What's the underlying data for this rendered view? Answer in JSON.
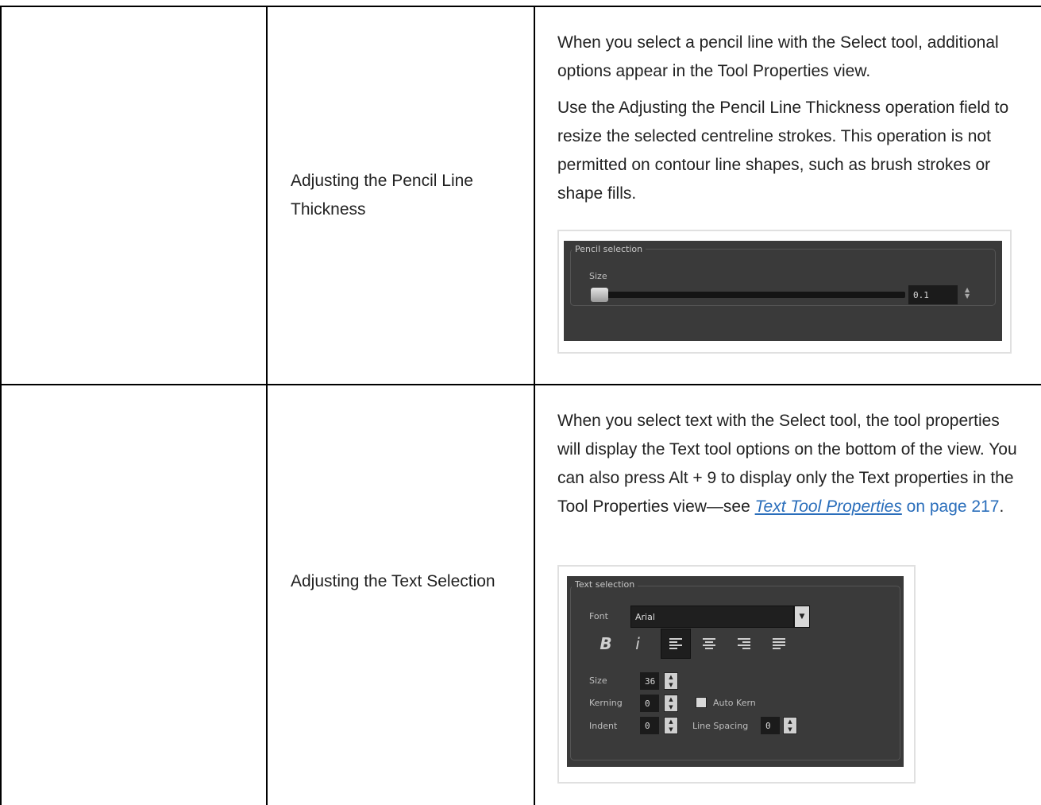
{
  "rows": [
    {
      "name": "Adjusting the Pencil Line Thickness",
      "paragraphs": [
        "When you select a pencil line with the Select tool, additional options appear in the Tool Properties view.",
        "Use the Adjusting the Pencil Line Thickness operation field to resize the selected centreline strokes. This operation is not permitted on contour line shapes, such as brush strokes or shape fills."
      ],
      "panel": {
        "group_title": "Pencil selection",
        "size_label": "Size",
        "size_value": "0.1",
        "slider_level": 0
      }
    },
    {
      "name": "Adjusting the Text Selection",
      "paragraph_before_link": "When you select text with the Select tool, the tool properties will display the Text tool options on the bottom of the view. You can also press Alt + 9 to display only the Text properties in the Tool Properties view—see ",
      "link_text": "Text Tool Properties",
      "page_ref": " on page 217",
      "paragraph_end": ".",
      "panel": {
        "group_title": "Text selection",
        "font_label": "Font",
        "font_value": "Arial",
        "bold_label": "B",
        "italic_label": "i",
        "size_label": "Size",
        "size_value": "36",
        "kerning_label": "Kerning",
        "kerning_value": "0",
        "auto_kern_label": "Auto Kern",
        "indent_label": "Indent",
        "indent_value": "0",
        "line_spacing_label": "Line Spacing",
        "line_spacing_value": "0",
        "selected_alignment": "left"
      }
    }
  ],
  "icons": {
    "dropdown": "chevron-down-icon",
    "spin": "spin-arrows-icon"
  }
}
